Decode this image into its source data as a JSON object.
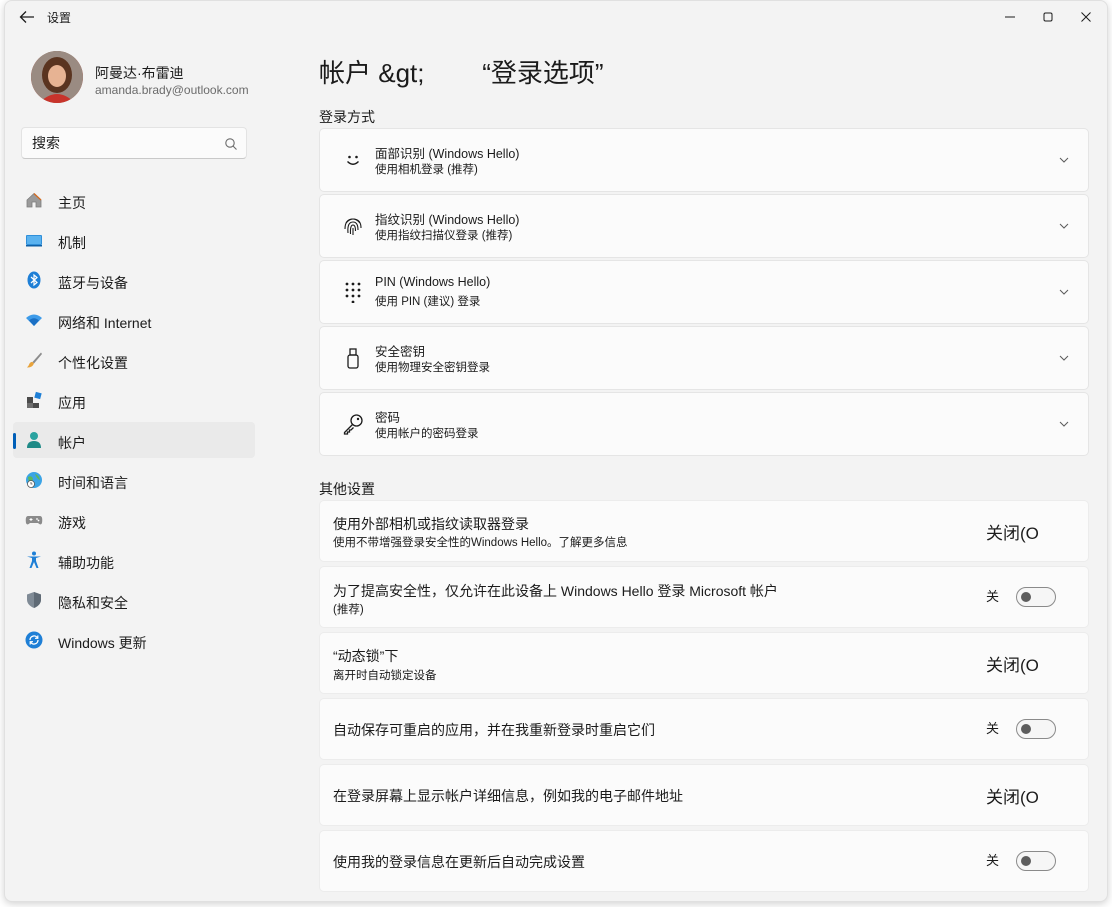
{
  "app": {
    "title": "设置"
  },
  "user": {
    "name": "阿曼达·布雷迪",
    "email": "amanda.brady@outlook.com"
  },
  "search": {
    "placeholder": "搜索"
  },
  "sidebar": {
    "items": [
      {
        "label": "主页",
        "icon": "home-icon"
      },
      {
        "label": "机制",
        "icon": "system-icon"
      },
      {
        "label": "蓝牙与设备",
        "icon": "bluetooth-icon"
      },
      {
        "label": "网络和 Internet",
        "icon": "wifi-icon"
      },
      {
        "label": "个性化设置",
        "icon": "brush-icon"
      },
      {
        "label": "应用",
        "icon": "apps-icon"
      },
      {
        "label": "帐户",
        "icon": "account-icon",
        "active": true
      },
      {
        "label": "时间和语言",
        "icon": "globe-clock-icon"
      },
      {
        "label": "游戏",
        "icon": "gamepad-icon"
      },
      {
        "label": "辅助功能",
        "icon": "accessibility-icon"
      },
      {
        "label": "隐私和安全",
        "icon": "shield-icon"
      },
      {
        "label": "Windows 更新",
        "icon": "update-icon"
      }
    ]
  },
  "page": {
    "title": "帐户 &gt;        “登录选项”",
    "signin_section": "登录方式",
    "other_section": "其他设置"
  },
  "signin_methods": [
    {
      "title": "面部识别 (Windows Hello)",
      "desc": "使用相机登录 (推荐)",
      "icon": "face-icon"
    },
    {
      "title": "指纹识别 (Windows Hello)",
      "desc": "使用指纹扫描仪登录 (推荐)",
      "icon": "fingerprint-icon"
    },
    {
      "title": "PIN (Windows Hello)",
      "desc": "使用 PIN (建议) 登录",
      "icon": "pin-keypad-icon"
    },
    {
      "title": "安全密钥",
      "desc": "使用物理安全密钥登录",
      "icon": "usb-key-icon"
    },
    {
      "title": "密码",
      "desc": "使用帐户的密码登录",
      "icon": "key-icon"
    }
  ],
  "other_settings": [
    {
      "title": "使用外部相机或指纹读取器登录",
      "desc": "使用不带增强登录安全性的Windows Hello。了解更多信息",
      "state": "关闭(O",
      "style": "big"
    },
    {
      "title": "为了提高安全性，仅允许在此设备上 Windows  Hello 登录 Microsoft 帐户",
      "desc": "(推荐)",
      "state": "关",
      "style": "toggle",
      "on": false
    },
    {
      "title": "“动态锁”下",
      "desc": "离开时自动锁定设备",
      "state": "关闭(O",
      "style": "big"
    },
    {
      "title": "自动保存可重启的应用，并在我重新登录时重启它们",
      "desc": "",
      "state": "关",
      "style": "toggle",
      "on": false
    },
    {
      "title": "在登录屏幕上显示帐户详细信息，例如我的电子邮件地址",
      "desc": "",
      "state": "关闭(O",
      "style": "big"
    },
    {
      "title": "使用我的登录信息在更新后自动完成设置",
      "desc": "",
      "state": "关",
      "style": "toggle",
      "on": false
    }
  ],
  "colors": {
    "accent": "#005fb8",
    "window_bg": "#f3f3f3",
    "card_bg": "#fbfbfb"
  }
}
